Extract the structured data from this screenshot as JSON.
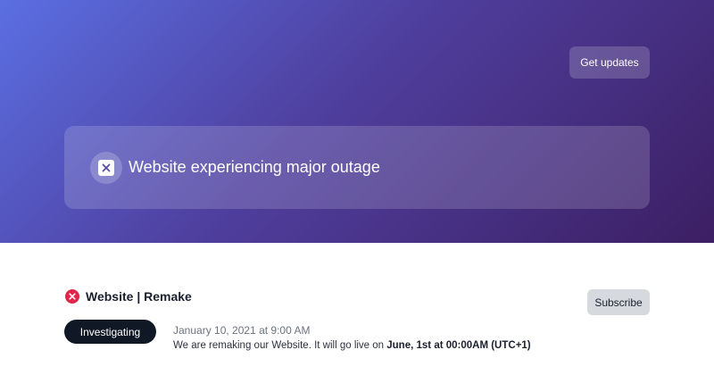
{
  "header": {
    "get_updates_label": "Get updates",
    "gradient_colors": [
      "#5b6fe2",
      "#4f3f9e",
      "#3c1f63"
    ]
  },
  "banner": {
    "icon": "close-square-icon",
    "title": "Website experiencing major outage"
  },
  "incident": {
    "status_icon": "error-circle-icon",
    "status_color": "#e0264a",
    "title": "Website | Remake",
    "subscribe_label": "Subscribe",
    "status_label": "Investigating",
    "timestamp": "January 10, 2021 at 9:00 AM",
    "message_prefix": "We are remaking our Website. It will go live on ",
    "message_bold": "June, 1st at 00:00AM (UTC+1)"
  }
}
